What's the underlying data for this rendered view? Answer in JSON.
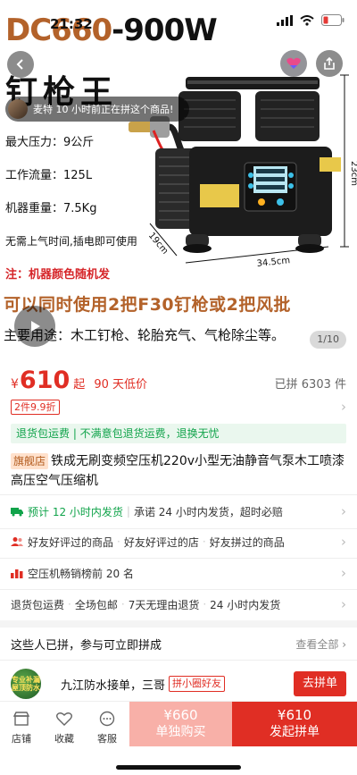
{
  "status_bar": {
    "time": "21:32"
  },
  "hero": {
    "title_brand": "DC660",
    "title_rest": "-900W",
    "subtitle": "钉枪王",
    "specs": [
      "最大压力：9公斤",
      "工作流量：125L",
      "机器重量：7.5Kg",
      "无需上气时间,插电即可使用"
    ],
    "note": "注：机器颜色随机发",
    "line1": "可以同时使用2把F30钉枪或2把风批",
    "line2": "主要用途：木工钉枪、轮胎充气、气枪除尘等。",
    "dim_height": "23cm",
    "dim_depth": "19cm",
    "dim_width": "34.5cm",
    "page_indicator": "1/10",
    "buyer_toast": "麦特 10 小时前正在拼这个商品!"
  },
  "price": {
    "currency": "¥",
    "value": "610",
    "suffix": "起",
    "low_tag": "90 天低价",
    "sold": "已拼 6303 件",
    "promo": "2件9.9折"
  },
  "return_bar": "退货包运费 | 不满意包退货运费，退换无忧",
  "product": {
    "store_tag": "旗舰店",
    "title": "铁成无刷变频空压机220v小型无油静音气泵木工喷漆高压空气压缩机"
  },
  "services": {
    "shipping_main": "预计 12 小时内发货",
    "shipping_sub": "承诺 24 小时内发货，超时必赔",
    "friends": [
      "好友好评过的商品",
      "好友好评过的店",
      "好友拼过的商品"
    ],
    "ranking": "空压机畅销榜前 20 名",
    "guarantees": [
      "退货包运费",
      "全场包邮",
      "7天无理由退货",
      "24 小时内发货"
    ]
  },
  "group": {
    "header": "这些人已拼，参与可立即拼成",
    "see_all": "查看全部",
    "avatar_text": "专业补漏 屋顶防水",
    "user_name": "九江防水接单，三哥",
    "user_tag": "拼小圈好友",
    "join_label": "去拼单"
  },
  "bottom_bar": {
    "store": "店铺",
    "favorite": "收藏",
    "service": "客服",
    "single_price": "¥660",
    "single_label": "单独购买",
    "group_price": "¥610",
    "group_label": "发起拼单"
  },
  "colors": {
    "accent": "#e02e24",
    "brand_brown": "#b3622a",
    "green": "#10a34a"
  }
}
